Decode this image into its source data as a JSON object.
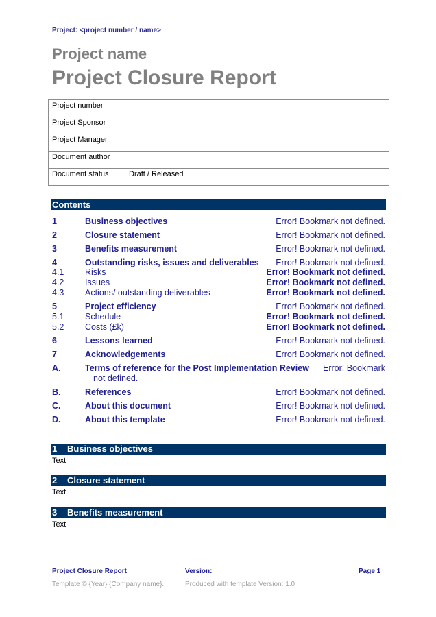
{
  "header": {
    "project_ref": "Project: <project number / name>"
  },
  "title": {
    "project_name": "Project name",
    "document_title": "Project Closure Report"
  },
  "meta_table": [
    {
      "label": "Project number",
      "value": ""
    },
    {
      "label": "Project Sponsor",
      "value": ""
    },
    {
      "label": "Project Manager",
      "value": ""
    },
    {
      "label": "Document author",
      "value": ""
    },
    {
      "label": "Document status",
      "value": "Draft / Released"
    }
  ],
  "contents": {
    "heading": "Contents",
    "entries": [
      {
        "num": "1",
        "title": "Business objectives",
        "page": "Error! Bookmark not defined.",
        "level": "main"
      },
      {
        "num": "2",
        "title": "Closure statement",
        "page": "Error! Bookmark not defined.",
        "level": "main"
      },
      {
        "num": "3",
        "title": "Benefits measurement",
        "page": "Error! Bookmark not defined.",
        "level": "main"
      },
      {
        "num": "4",
        "title": "Outstanding risks, issues and deliverables",
        "page": "Error! Bookmark not defined.",
        "level": "main"
      },
      {
        "num": "4.1",
        "title": "Risks",
        "page": "Error! Bookmark not defined.",
        "level": "sub"
      },
      {
        "num": "4.2",
        "title": "Issues",
        "page": "Error! Bookmark not defined.",
        "level": "sub"
      },
      {
        "num": "4.3",
        "title": "Actions/ outstanding deliverables",
        "page": "Error! Bookmark not defined.",
        "level": "sub"
      },
      {
        "num": "5",
        "title": "Project efficiency",
        "page": "Error! Bookmark not defined.",
        "level": "main"
      },
      {
        "num": "5.1",
        "title": "Schedule",
        "page": "Error! Bookmark not defined.",
        "level": "sub"
      },
      {
        "num": "5.2",
        "title": "Costs (£k)",
        "page": "Error! Bookmark not defined.",
        "level": "sub"
      },
      {
        "num": "6",
        "title": "Lessons learned",
        "page": "Error! Bookmark not defined.",
        "level": "main"
      },
      {
        "num": "7",
        "title": "Acknowledgements",
        "page": "Error! Bookmark not defined.",
        "level": "main"
      },
      {
        "num": "A.",
        "title": "Terms of reference for the Post Implementation Review",
        "page": "Error! Bookmark",
        "page_wrap": "not defined.",
        "level": "main"
      },
      {
        "num": "B.",
        "title": "References",
        "page": "Error! Bookmark not defined.",
        "level": "main"
      },
      {
        "num": "C.",
        "title": "About this document",
        "page": "Error! Bookmark not defined.",
        "level": "main"
      },
      {
        "num": "D.",
        "title": "About this template",
        "page": "Error! Bookmark not defined.",
        "level": "main"
      }
    ]
  },
  "sections": [
    {
      "num": "1",
      "title": "Business objectives",
      "body": "Text"
    },
    {
      "num": "2",
      "title": "Closure statement",
      "body": "Text"
    },
    {
      "num": "3",
      "title": "Benefits measurement",
      "body": "Text"
    }
  ],
  "footer": {
    "doc_name": "Project Closure Report",
    "version_label": "Version:",
    "page": "Page 1",
    "copyright": "Template © {Year} {Company name}.",
    "template_version": "Produced with template Version: 1.0"
  },
  "colors": {
    "bar": "#003366",
    "toc_text": "#1f1f8f",
    "title_gray": "#808080"
  }
}
